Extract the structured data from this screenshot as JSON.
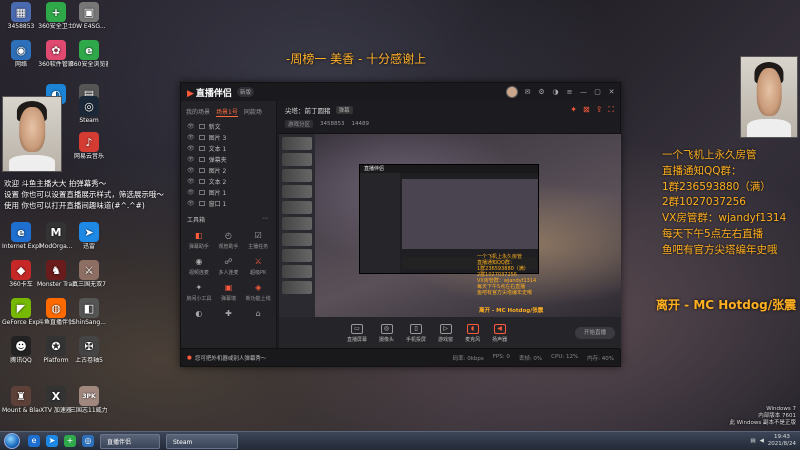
{
  "desktop_icons": [
    {
      "label": "3458853",
      "glyph": "▦",
      "color": "#4a6ab0"
    },
    {
      "label": "360安全卫士",
      "glyph": "+",
      "color": "#2fa84a"
    },
    {
      "label": "0W E4SG...",
      "glyph": "▣",
      "color": "#777"
    },
    {
      "label": "网络",
      "glyph": "◉",
      "color": "#2d6fb8"
    },
    {
      "label": "360软件管家",
      "glyph": "✿",
      "color": "#e04a70"
    },
    {
      "label": "360安全浏览器",
      "glyph": "e",
      "color": "#2fa84a"
    },
    {
      "label": "",
      "glyph": "◐",
      "color": "#1b84d6"
    },
    {
      "label": "",
      "glyph": "▤",
      "color": "#555"
    },
    {
      "label": "Steam",
      "glyph": "◎",
      "color": "#1b2838"
    },
    {
      "label": "网易云音乐",
      "glyph": "♪",
      "color": "#d43c33"
    },
    {
      "label": "Internet Explorer",
      "glyph": "e",
      "color": "#1f6fd1"
    },
    {
      "label": "ModOrga...",
      "glyph": "M",
      "color": "#333"
    },
    {
      "label": "迅雷",
      "glyph": "➤",
      "color": "#1e88e5"
    },
    {
      "label": "360卡车",
      "glyph": "◆",
      "color": "#c62828"
    },
    {
      "label": "Monster Train",
      "glyph": "♞",
      "color": "#6a1b1b"
    },
    {
      "label": "真三国无双7",
      "glyph": "⚔",
      "color": "#8d6e63"
    },
    {
      "label": "GeForce Experience",
      "glyph": "◤",
      "color": "#76b900"
    },
    {
      "label": "斗鱼直播伴侣",
      "glyph": "◍",
      "color": "#ff6a00"
    },
    {
      "label": "ShinSang...",
      "glyph": "◧",
      "color": "#555"
    },
    {
      "label": "腾讯QQ",
      "glyph": "☻",
      "color": "#222"
    },
    {
      "label": "Platform",
      "glyph": "✪",
      "color": "#333"
    },
    {
      "label": "上古卷轴5",
      "glyph": "✠",
      "color": "#444"
    },
    {
      "label": "Mount & Blade II...",
      "glyph": "♜",
      "color": "#5d4037"
    },
    {
      "label": "XTV 加速器",
      "glyph": "X",
      "color": "#333"
    },
    {
      "label": "三国志11威力加强",
      "glyph": "3PK",
      "color": "#a1887f"
    }
  ],
  "overlay": {
    "banner": "-周榜一 美香 - 十分感谢上",
    "info_lines": [
      "一个飞机上永久房管",
      "直播通知QQ群：",
      "1群236593880（满）",
      "2群1027037256",
      "VX房管群：wjandyf1314",
      "每天下午5点左右直播",
      "鱼吧有官方尖塔编年史哦"
    ],
    "leave_text": "离开 - MC Hotdog/张震",
    "chat": [
      "欢迎 斗鱼主播大大 拍弹幕秀～",
      "设置 你也可以设置直播展示样式，筛选展示哦～",
      "使用 你也可以打开直播间趣味道(#^.^#)"
    ]
  },
  "app": {
    "logo": "直播伴侣",
    "version": "新版",
    "scene_tabs": [
      "我的场景",
      "场景1号",
      "同款场"
    ],
    "sources": [
      {
        "label": "新文"
      },
      {
        "label": "图片 3"
      },
      {
        "label": "文本 1"
      },
      {
        "label": "弹幕夹"
      },
      {
        "label": "图片 2"
      },
      {
        "label": "文本 2"
      },
      {
        "label": "图片 1"
      },
      {
        "label": "窗口 1"
      }
    ],
    "tools_title": "工具箱",
    "tools": [
      {
        "label": "弹幕助手",
        "glyph": "◧",
        "grey": false
      },
      {
        "label": "观管助手",
        "glyph": "◴",
        "grey": true
      },
      {
        "label": "主播任务",
        "glyph": "☑",
        "grey": true
      },
      {
        "label": "视频连麦",
        "glyph": "◉",
        "grey": true
      },
      {
        "label": "多人连麦",
        "glyph": "☍",
        "grey": true
      },
      {
        "label": "超级PK",
        "glyph": "⚔",
        "grey": false
      },
      {
        "label": "房间小工具",
        "glyph": "✦",
        "grey": true
      },
      {
        "label": "弹幕墙",
        "glyph": "▣",
        "grey": false
      },
      {
        "label": "新功能上线",
        "glyph": "◈",
        "grey": false
      },
      {
        "label": "",
        "glyph": "◐",
        "grey": true
      },
      {
        "label": "",
        "glyph": "✚",
        "grey": true
      },
      {
        "label": "",
        "glyph": "⌂",
        "grey": true
      }
    ],
    "room": {
      "title": "尖塔：前丁圆猪",
      "tag": "弹幕",
      "category": "游戏分区",
      "stat1": "3458853",
      "stat2": "14489"
    },
    "bottom_controls": [
      {
        "label": "直播屏幕",
        "glyph": "▭",
        "red": false
      },
      {
        "label": "摄像头",
        "glyph": "◎",
        "red": false
      },
      {
        "label": "手机投屏",
        "glyph": "▯",
        "red": false
      },
      {
        "label": "游戏窗",
        "glyph": "▷",
        "red": false
      },
      {
        "label": "麦克风",
        "glyph": "◖",
        "red": true
      },
      {
        "label": "扬声器",
        "glyph": "◀",
        "red": true
      }
    ],
    "start_button": "开始直播",
    "notice": "您可把外机器或别人弹幕秀～",
    "status_stats": [
      "码率: 0kbps",
      "FPS: 0",
      "丢帧: 0%",
      "CPU: 12%",
      "内存: 40%"
    ]
  },
  "preview": {
    "inner_title": "直播伴侣",
    "caption_lines": [
      "一个飞机上永久房管",
      "直播通知QQ群：",
      "1群236593880（满）",
      "2群1027037256",
      "VX房管群：wjandyf1314",
      "每天下午5点左右直播",
      "鱼吧有官方尖塔编年史哦"
    ],
    "leave": "离开 - MC Hotdog/张震"
  },
  "taskbar": {
    "task1": "直播伴侣",
    "task2": "Steam",
    "time": "19:43",
    "date": "2021/8/24"
  },
  "watermark": {
    "line1": "Windows 7",
    "line2": "内部版本 7601",
    "line3": "此 Windows 副本不是正版"
  }
}
